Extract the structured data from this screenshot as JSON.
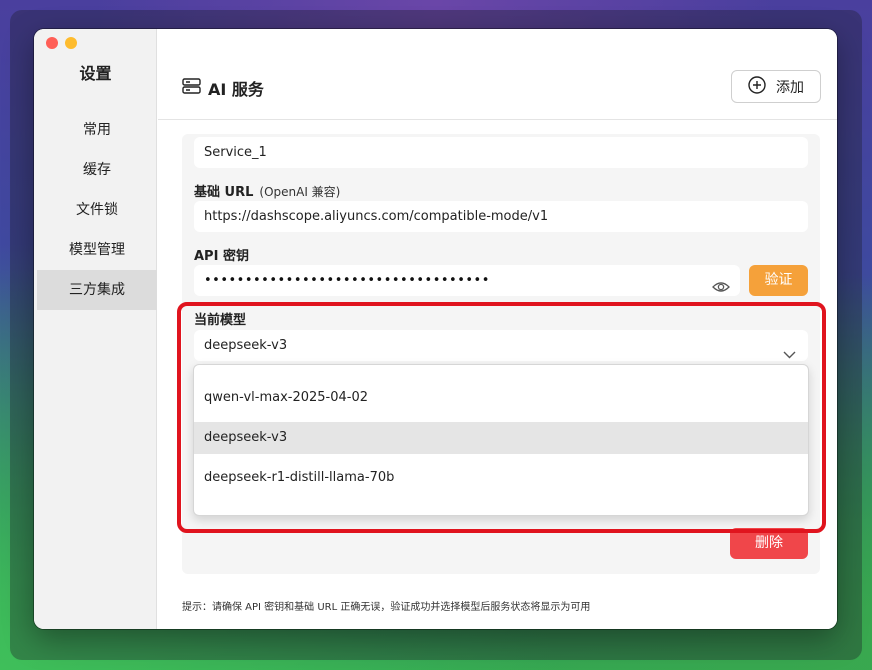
{
  "sidebar": {
    "title": "设置",
    "items": [
      {
        "label": "常用"
      },
      {
        "label": "缓存"
      },
      {
        "label": "文件锁"
      },
      {
        "label": "模型管理"
      },
      {
        "label": "三方集成"
      }
    ],
    "active_index": 4
  },
  "header": {
    "icon": "server-icon",
    "title": "AI 服务",
    "add_label": "添加"
  },
  "form": {
    "service_name_value": "Service_1",
    "base_url_label": "基础 URL",
    "base_url_hint": "(OpenAI 兼容)",
    "base_url_value": "https://dashscope.aliyuncs.com/compatible-mode/v1",
    "api_key_label": "API 密钥",
    "api_key_masked": "•••••••••••••••••••••••••••••••••••",
    "verify_label": "验证",
    "model_label": "当前模型",
    "model_selected": "deepseek-v3",
    "model_options": [
      "qwen-vl-max-2025-04-02",
      "deepseek-v3",
      "deepseek-r1-distill-llama-70b"
    ],
    "delete_label": "删除"
  },
  "hint": "提示：请确保 API 密钥和基础 URL 正确无误，验证成功并选择模型后服务状态将显示为可用",
  "colors": {
    "verify": "#f5a13a",
    "delete": "#f0464a",
    "highlight": "#e0141e"
  }
}
